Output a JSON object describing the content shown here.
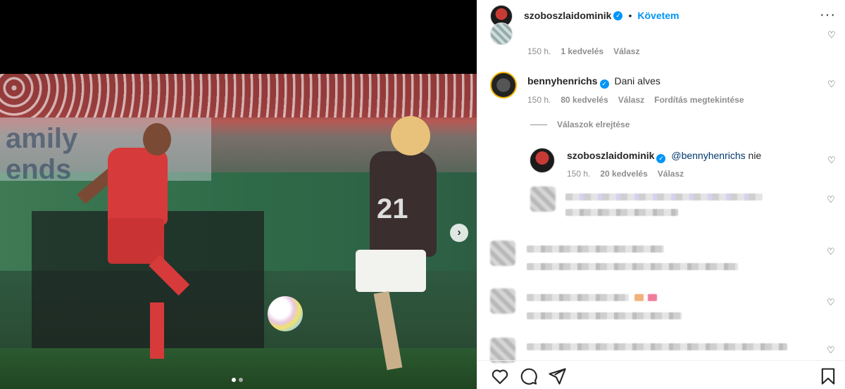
{
  "header": {
    "username": "szoboszlaidominik",
    "follow_label": "Követem",
    "more_icon": "more-horizontal-icon"
  },
  "media": {
    "banner_text": "amily\nends",
    "jersey_number": "21",
    "dots_count": 2
  },
  "comments": [
    {
      "meta": {
        "time": "150 h.",
        "likes": "1 kedvelés",
        "reply": "Válasz"
      }
    },
    {
      "username": "bennyhenrichs",
      "text": "Dani alves",
      "meta": {
        "time": "150 h.",
        "likes": "80 kedvelés",
        "reply": "Válasz",
        "translate": "Fordítás megtekintése"
      }
    }
  ],
  "hide_replies_label": "Válaszok elrejtése",
  "reply": {
    "username": "szoboszlaidominik",
    "mention": "@bennyhenrichs",
    "text": " nie",
    "meta": {
      "time": "150 h.",
      "likes": "20 kedvelés",
      "reply": "Válasz"
    }
  },
  "actions": {
    "like_icon": "heart-icon",
    "comment_icon": "comment-icon",
    "share_icon": "share-icon",
    "save_icon": "bookmark-icon"
  },
  "colors": {
    "accent": "#0095f6",
    "mention": "#00376b",
    "meta_gray": "#8e8e8e"
  }
}
